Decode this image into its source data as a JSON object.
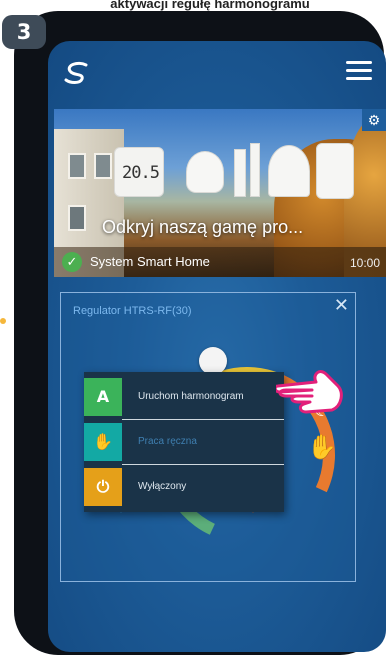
{
  "step": "3",
  "top_caption": "aktywacji regułę harmonogramu",
  "header": {
    "logo_icon": "salus-logo-icon",
    "menu_icon": "hamburger-menu-icon"
  },
  "banner": {
    "thermostat_display": "20.5",
    "caption": "Odkryj naszą gamę pro...",
    "status_label": "System Smart Home",
    "time": "10:00",
    "settings_icon": "gear-icon",
    "check_icon": "check-circle-icon"
  },
  "panel": {
    "title": "Regulator HTRS-RF(30)",
    "close_icon": "close-icon"
  },
  "mode_menu": {
    "items": [
      {
        "icon": "schedule-auto-icon",
        "glyph": "A",
        "label": "Uruchom harmonogram",
        "color": "#3bb35a"
      },
      {
        "icon": "hand-manual-icon",
        "glyph": "✋",
        "label": "Praca ręczna",
        "color": "#13a9a4"
      },
      {
        "icon": "power-icon",
        "glyph": "⏻",
        "label": "Wyłączony",
        "color": "#e5a019"
      }
    ]
  },
  "colors": {
    "screen_bg": "#1d5c98",
    "badge_bg": "#3e4b58",
    "menu_bg": "#1a3348"
  }
}
